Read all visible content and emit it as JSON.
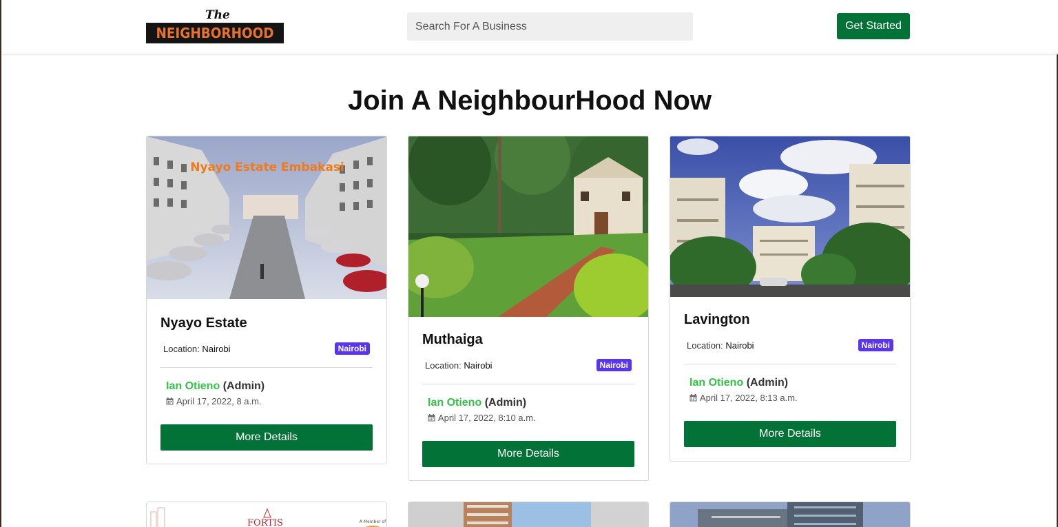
{
  "header": {
    "logo_top": "The",
    "logo_main": "NEIGHBORHOOD",
    "search_placeholder": "Search For A Business",
    "cta_label": "Get Started"
  },
  "page": {
    "heading": "Join A NeighbourHood Now"
  },
  "cards": [
    {
      "image_caption": "Nyayo Estate Embakasi",
      "title": "Nyayo Estate",
      "location_label": "Location:",
      "location_value": "Nairobi",
      "badge": "Nairobi",
      "admin_name": "Ian Otieno",
      "admin_role": "(Admin)",
      "date": "April 17, 2022, 8 a.m.",
      "button": "More Details"
    },
    {
      "title": "Muthaiga",
      "location_label": "Location:",
      "location_value": "Nairobi",
      "badge": "Nairobi",
      "admin_name": "Ian Otieno",
      "admin_role": "(Admin)",
      "date": "April 17, 2022, 8:10 a.m.",
      "button": "More Details"
    },
    {
      "title": "Lavington",
      "location_label": "Location:",
      "location_value": "Nairobi",
      "badge": "Nairobi",
      "admin_name": "Ian Otieno",
      "admin_role": "(Admin)",
      "date": "April 17, 2022, 8:13 a.m.",
      "button": "More Details"
    }
  ],
  "bottom_cards": [
    {
      "logo_text": "FORTIS",
      "small_text": "A Member of"
    },
    {},
    {}
  ],
  "colors": {
    "primary_green": "#037236",
    "admin_green": "#35c24a",
    "badge_purple": "#5a35f0",
    "logo_orange": "#e8742b"
  }
}
